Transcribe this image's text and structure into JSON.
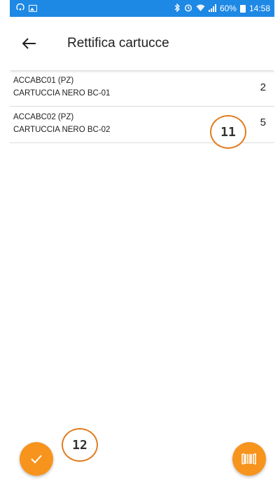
{
  "statusbar": {
    "right_text": "60%",
    "time": "14:58"
  },
  "appbar": {
    "title": "Rettifica cartucce"
  },
  "items": [
    {
      "code": "ACCABC01 (PZ)",
      "description": "CARTUCCIA NERO BC-01",
      "quantity": "2"
    },
    {
      "code": "ACCABC02 (PZ)",
      "description": "CARTUCCIA NERO BC-02",
      "quantity": "5"
    }
  ],
  "annotations": {
    "marker_a": "11",
    "marker_b": "12"
  },
  "colors": {
    "statusbar": "#1e88e5",
    "accent": "#f7941d",
    "marker_ring": "#e27b1f"
  },
  "icons": {
    "back": "arrow-left-icon",
    "confirm": "checkmark-icon",
    "scan": "barcode-icon"
  }
}
